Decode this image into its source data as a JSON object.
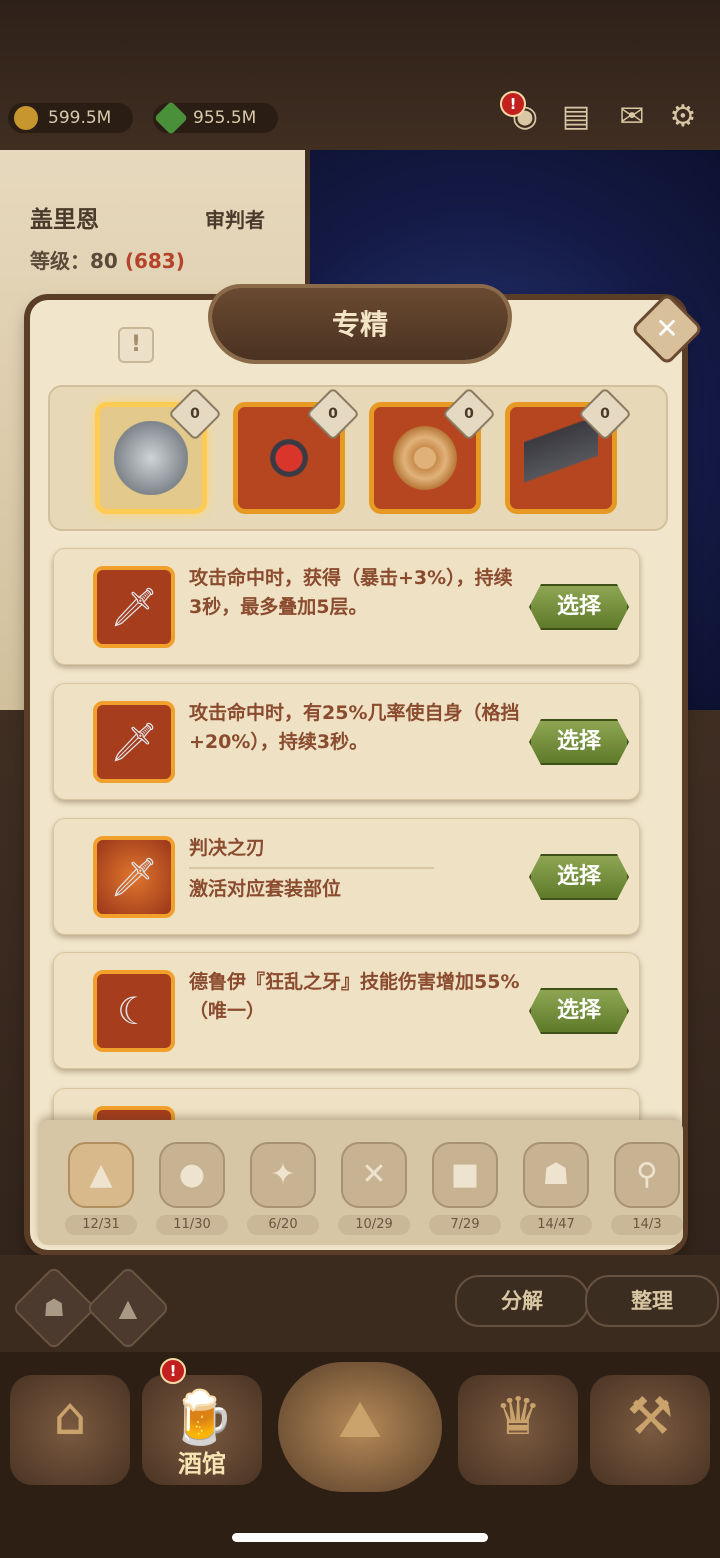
{
  "resources": {
    "gold": "599.5M",
    "gems": "955.5M"
  },
  "hero": {
    "name": "盖里恩",
    "class": "审判者",
    "level_label": "等级：80",
    "level_extra": "(683)"
  },
  "panel": {
    "title": "专精",
    "close_glyph": "✕",
    "info_glyph": "!"
  },
  "slots": [
    {
      "badge": "0",
      "name": "gauntlet-icon",
      "selected": true
    },
    {
      "badge": "0",
      "name": "amulet-icon",
      "selected": false
    },
    {
      "badge": "0",
      "name": "pendant-icon",
      "selected": false
    },
    {
      "badge": "0",
      "name": "boots-icon",
      "selected": false
    }
  ],
  "options": [
    {
      "desc": "攻击命中时，获得（暴击+3%），持续3秒，最多叠加5层。",
      "button": "选择"
    },
    {
      "desc": "攻击命中时，有25%几率使自身（格挡+20%），持续3秒。",
      "button": "选择"
    },
    {
      "title": "判决之刃",
      "sub": "激活对应套装部位",
      "button": "选择"
    },
    {
      "desc": "德鲁伊『狂乱之牙』技能伤害增加55%（唯一）",
      "button": "选择"
    }
  ],
  "filters": [
    {
      "count": "12/31",
      "icon": "boot-filter-icon",
      "glyph": "▲",
      "active": true
    },
    {
      "count": "11/30",
      "icon": "meat-filter-icon",
      "glyph": "●"
    },
    {
      "count": "6/20",
      "icon": "sword-filter-icon",
      "glyph": "✦"
    },
    {
      "count": "10/29",
      "icon": "shield-filter-icon",
      "glyph": "✕"
    },
    {
      "count": "7/29",
      "icon": "book-filter-icon",
      "glyph": "■"
    },
    {
      "count": "14/47",
      "icon": "helmet-filter-icon",
      "glyph": "☗"
    },
    {
      "count": "14/3",
      "icon": "magnifier-filter-icon",
      "glyph": "⚲"
    }
  ],
  "actions": {
    "decompose": "分解",
    "organize": "整理"
  },
  "nav": {
    "tavern_label": "酒馆"
  },
  "colors": {
    "accent_red": "#c21f1f",
    "select_green": "#6f8a35",
    "frame_orange": "#f0a02b"
  }
}
